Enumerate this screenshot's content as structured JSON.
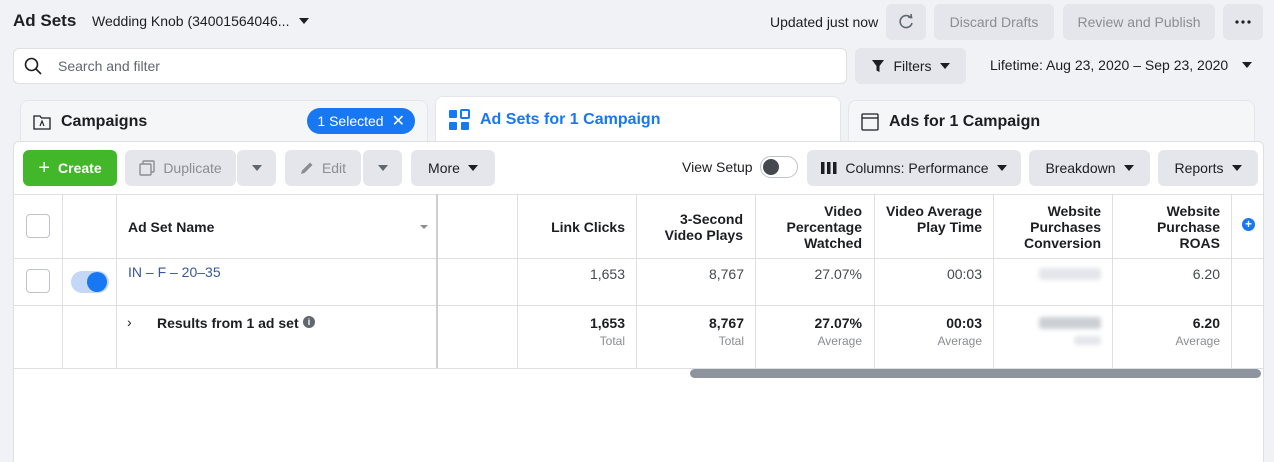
{
  "header": {
    "title": "Ad Sets",
    "account": "Wedding Knob (34001564046...",
    "updated": "Updated just now",
    "discard": "Discard Drafts",
    "review": "Review and Publish"
  },
  "search": {
    "placeholder": "Search and filter"
  },
  "filters": {
    "label": "Filters",
    "date_range": "Lifetime: Aug 23, 2020 – Sep 23, 2020"
  },
  "tabs": {
    "campaigns": "Campaigns",
    "selected": "1 Selected",
    "adsets": "Ad Sets for 1 Campaign",
    "ads": "Ads for 1 Campaign"
  },
  "toolbar": {
    "create": "Create",
    "duplicate": "Duplicate",
    "edit": "Edit",
    "more": "More",
    "view_setup": "View Setup",
    "columns": "Columns: Performance",
    "breakdown": "Breakdown",
    "reports": "Reports"
  },
  "table": {
    "headers": {
      "name": "Ad Set Name",
      "link_clicks": "Link Clicks",
      "video_plays": "3-Second Video Plays",
      "video_pct": "Video Percentage Watched",
      "video_avg": "Video Average Play Time",
      "web_conv": "Website Purchases Conversion",
      "web_roas": "Website Purchase ROAS"
    },
    "row": {
      "name": "IN – F – 20–35",
      "link_clicks": "1,653",
      "video_plays": "8,767",
      "video_pct": "27.07%",
      "video_avg": "00:03",
      "web_roas": "6.20",
      "active": true
    },
    "results": {
      "label": "Results from 1 ad set",
      "link_clicks": "1,653",
      "link_clicks_sub": "Total",
      "video_plays": "8,767",
      "video_plays_sub": "Total",
      "video_pct": "27.07%",
      "video_pct_sub": "Average",
      "video_avg": "00:03",
      "video_avg_sub": "Average",
      "web_roas": "6.20",
      "web_roas_sub": "Average"
    }
  },
  "colors": {
    "accent": "#1877f2",
    "create": "#42b72a"
  }
}
